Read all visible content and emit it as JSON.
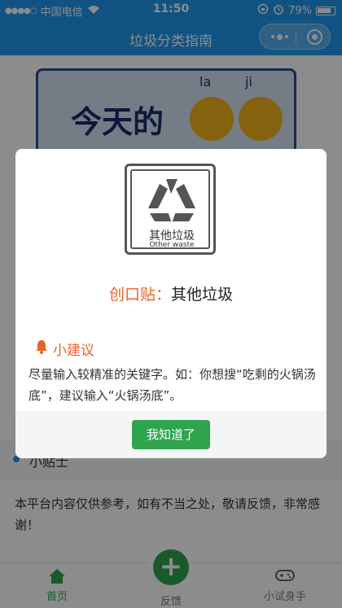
{
  "status": {
    "carrier": "中国电信",
    "time": "11:50",
    "battery": "79%"
  },
  "header": {
    "title": "垃圾分类指南"
  },
  "banner": {
    "headline": "今天的",
    "pinyin_left": "la",
    "pinyin_right": "ji"
  },
  "page": {
    "tip_label": "小贴士",
    "notice": "本平台内容仅供参考，如有不当之处，敬请反馈，非常感谢！"
  },
  "tabbar": {
    "tabs": [
      {
        "label": "首页",
        "icon": "home-icon",
        "active": true
      },
      {
        "label": "反馈",
        "icon": "plus-icon",
        "active": false
      },
      {
        "label": "小试身手",
        "icon": "gamepad-icon",
        "active": false
      }
    ]
  },
  "modal": {
    "icon_cn": "其他垃圾",
    "icon_en": "Other waste",
    "item_name": "创口贴：",
    "item_category": "其他垃圾",
    "suggestion_title": "小建议",
    "suggestion_text": "尽量输入较精准的关键字。如：你想搜“吃剩的火锅汤底”，建议输入“火锅汤底”。",
    "ok_label": "我知道了"
  },
  "colors": {
    "primary": "#1e97ee",
    "green": "#2ea44f",
    "orange": "#e8642b"
  }
}
